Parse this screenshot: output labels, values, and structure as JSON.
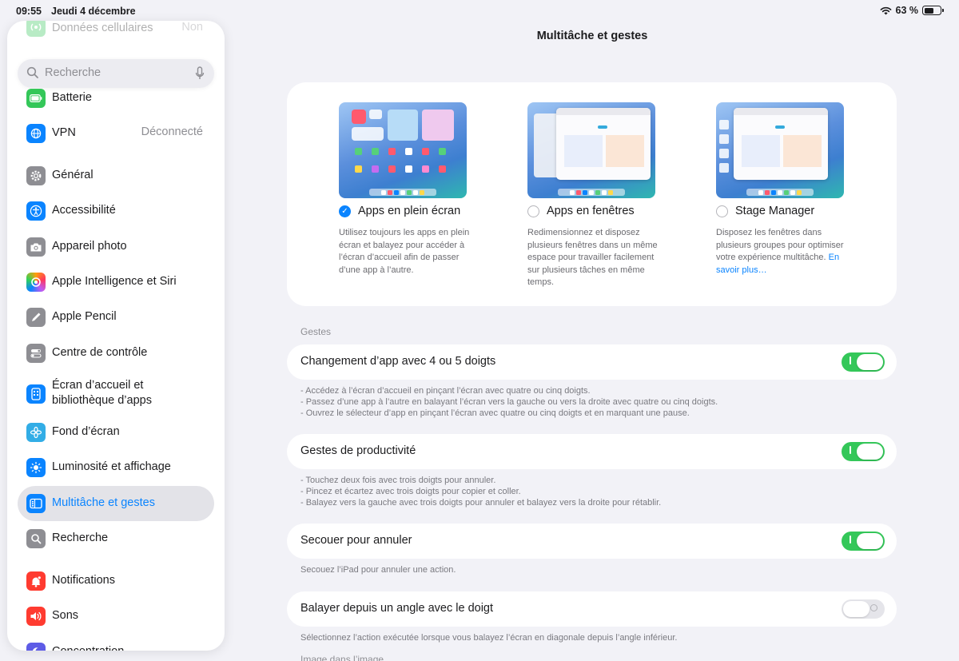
{
  "status_bar": {
    "time": "09:55",
    "date": "Jeudi 4 décembre",
    "battery": "63 %",
    "battery_level": 0.63
  },
  "sidebar": {
    "search_placeholder": "Recherche",
    "items": [
      {
        "label": "Données cellulaires",
        "value": "Non",
        "icon": "antenna-icon",
        "color": "#34c759"
      },
      {
        "label": "Batterie",
        "icon": "battery-icon",
        "color": "#34c759"
      },
      {
        "label": "VPN",
        "value": "Déconnecté",
        "icon": "globe-icon",
        "color": "#0a84ff"
      },
      {
        "label": "Général",
        "icon": "gear-icon",
        "color": "#8e8e93"
      },
      {
        "label": "Accessibilité",
        "icon": "accessibility-icon",
        "color": "#0a84ff"
      },
      {
        "label": "Appareil photo",
        "icon": "camera-icon",
        "color": "#8e8e93"
      },
      {
        "label": "Apple Intelligence et Siri",
        "icon": "siri-icon",
        "color": "#ff6b3d"
      },
      {
        "label": "Apple Pencil",
        "icon": "pencil-icon",
        "color": "#8e8e93"
      },
      {
        "label": "Centre de contrôle",
        "icon": "toggles-icon",
        "color": "#8e8e93"
      },
      {
        "label": "Écran d’accueil et bibliothèque d’apps",
        "icon": "home-screen-icon",
        "color": "#0a84ff"
      },
      {
        "label": "Fond d’écran",
        "icon": "flower-icon",
        "color": "#32ade6"
      },
      {
        "label": "Luminosité et affichage",
        "icon": "sun-icon",
        "color": "#0a84ff"
      },
      {
        "label": "Multitâche et gestes",
        "icon": "multitasking-icon",
        "color": "#0a84ff",
        "selected": true
      },
      {
        "label": "Recherche",
        "icon": "search-icon",
        "color": "#8e8e93"
      },
      {
        "label": "Notifications",
        "icon": "bell-icon",
        "color": "#ff3b30"
      },
      {
        "label": "Sons",
        "icon": "speaker-icon",
        "color": "#ff3b30"
      },
      {
        "label": "Concentration",
        "icon": "moon-icon",
        "color": "#5e5ce6"
      }
    ]
  },
  "main": {
    "title": "Multitâche et gestes",
    "modes": [
      {
        "name": "Apps en plein écran",
        "checked": true,
        "description": "Utilisez toujours les apps en plein écran et balayez pour accéder à l’écran d’accueil afin de passer d’une app à l’autre."
      },
      {
        "name": "Apps en fenêtres",
        "checked": false,
        "description": "Redimensionnez et disposez plusieurs fenêtres dans un même espace pour travailler facilement sur plusieurs tâches en même temps."
      },
      {
        "name": "Stage Manager",
        "checked": false,
        "description": "Disposez les fenêtres dans plusieurs groupes pour optimiser votre expérience multitâche.",
        "link": "En savoir plus…"
      }
    ],
    "gestures_header": "Gestes",
    "settings": [
      {
        "label": "Changement d’app avec 4 ou 5 doigts",
        "on": true,
        "notes": [
          "- Accédez à l’écran d’accueil en pinçant l’écran avec quatre ou cinq doigts.",
          "- Passez d’une app à l’autre en balayant l’écran vers la gauche ou vers la droite avec quatre ou cinq doigts.",
          "- Ouvrez le sélecteur d’app en pinçant l’écran avec quatre ou cinq doigts et en marquant une pause."
        ]
      },
      {
        "label": "Gestes de productivité",
        "on": true,
        "notes": [
          "- Touchez deux fois avec trois doigts pour annuler.",
          "- Pincez et écartez avec trois doigts pour copier et coller.",
          "- Balayez vers la gauche avec trois doigts pour annuler et balayez vers la droite pour rétablir."
        ]
      },
      {
        "label": "Secouer pour annuler",
        "on": true,
        "notes": [
          "Secouez l’iPad pour annuler une action."
        ]
      },
      {
        "label": "Balayer depuis un angle avec le doigt",
        "on": false,
        "notes": [
          "Sélectionnez l’action exécutée lorsque vous balayez l’écran en diagonale depuis l’angle inférieur."
        ]
      }
    ],
    "next_header": "Image dans l’image"
  }
}
